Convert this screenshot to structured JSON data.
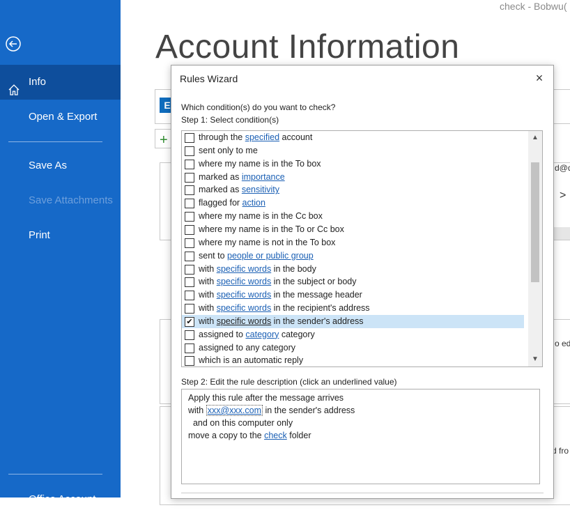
{
  "window": {
    "title_fragment": "check - Bobwu("
  },
  "sidebar": {
    "info": "Info",
    "open_export": "Open & Export",
    "save_as": "Save As",
    "save_attachments": "Save Attachments",
    "print": "Print",
    "office_account": "Office Account"
  },
  "page": {
    "title": "Account Information"
  },
  "background": {
    "email_fragment": "d@q",
    "text_fragment_1": "o ed",
    "text_fragment_2": "d fro"
  },
  "dialog": {
    "title": "Rules Wizard",
    "close": "×",
    "question": "Which condition(s) do you want to check?",
    "step1": "Step 1: Select condition(s)",
    "conditions": [
      {
        "pre": "through the ",
        "link": "specified",
        "post": " account",
        "checked": false
      },
      {
        "pre": "sent only to me",
        "link": "",
        "post": "",
        "checked": false
      },
      {
        "pre": "where my name is in the To box",
        "link": "",
        "post": "",
        "checked": false
      },
      {
        "pre": "marked as ",
        "link": "importance",
        "post": "",
        "checked": false
      },
      {
        "pre": "marked as ",
        "link": "sensitivity",
        "post": "",
        "checked": false
      },
      {
        "pre": "flagged for ",
        "link": "action",
        "post": "",
        "checked": false
      },
      {
        "pre": "where my name is in the Cc box",
        "link": "",
        "post": "",
        "checked": false
      },
      {
        "pre": "where my name is in the To or Cc box",
        "link": "",
        "post": "",
        "checked": false
      },
      {
        "pre": "where my name is not in the To box",
        "link": "",
        "post": "",
        "checked": false
      },
      {
        "pre": "sent to ",
        "link": "people or public group",
        "post": "",
        "checked": false
      },
      {
        "pre": "with ",
        "link": "specific words",
        "post": " in the body",
        "checked": false
      },
      {
        "pre": "with ",
        "link": "specific words",
        "post": " in the subject or body",
        "checked": false
      },
      {
        "pre": "with ",
        "link": "specific words",
        "post": " in the message header",
        "checked": false
      },
      {
        "pre": "with ",
        "link": "specific words",
        "post": " in the recipient's address",
        "checked": false
      },
      {
        "pre": "with ",
        "link": "specific words",
        "post": " in the sender's address",
        "checked": true
      },
      {
        "pre": "assigned to ",
        "link": "category",
        "post": " category",
        "checked": false
      },
      {
        "pre": "assigned to any category",
        "link": "",
        "post": "",
        "checked": false
      },
      {
        "pre": "which is an automatic reply",
        "link": "",
        "post": "",
        "checked": false
      }
    ],
    "step2": "Step 2: Edit the rule description (click an underlined value)",
    "description": {
      "line1": "Apply this rule after the message arrives",
      "line2_pre": "with ",
      "line2_link": "xxx@xxx.com",
      "line2_post": " in the sender's address",
      "line3": "  and on this computer only",
      "line4_pre": "move a copy to the ",
      "line4_link": "check",
      "line4_post": " folder"
    }
  },
  "colors": {
    "sidebar": "#1669c8",
    "sidebar_active": "#0e4e9c",
    "link": "#1a5fb4",
    "selection": "#cce4f7"
  }
}
